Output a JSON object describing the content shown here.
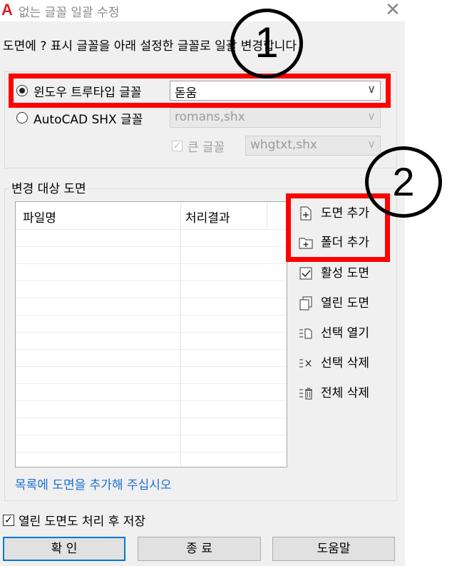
{
  "window": {
    "title": "없는 글꼴 일괄 수정",
    "app_icon": "A"
  },
  "prompt": "도면에 ? 표시 글꼴을 아래 설정한 글꼴로 일괄 변경합니다",
  "font_options": {
    "truetype": {
      "label": "윈도우 트루타입 글꼴",
      "selected": true,
      "value": "돋움"
    },
    "shx": {
      "label": "AutoCAD  SHX 글꼴",
      "selected": false,
      "value": "romans,shx"
    },
    "bigfont": {
      "label": "큰 글꼴",
      "checked": true,
      "value": "whgtxt,shx"
    }
  },
  "target_group": {
    "title": "변경 대상 도면",
    "columns": [
      "파일명",
      "처리결과"
    ],
    "hint": "목록에 도면을 추가해 주십시오"
  },
  "side_buttons": [
    {
      "label": "도면 추가",
      "icon": "add-drawing-icon"
    },
    {
      "label": "폴더 추가",
      "icon": "add-folder-icon"
    },
    {
      "label": "활성 도면",
      "icon": "active-drawing-icon"
    },
    {
      "label": "열린 도면",
      "icon": "open-drawings-icon"
    },
    {
      "label": "선택 열기",
      "icon": "open-selected-icon"
    },
    {
      "label": "선택 삭제",
      "icon": "delete-selected-icon"
    },
    {
      "label": "전체 삭제",
      "icon": "delete-all-icon"
    }
  ],
  "save_option": {
    "label": "열린 도면도 처리 후 저장",
    "checked": true
  },
  "buttons": {
    "ok": "확 인",
    "close": "종 료",
    "help": "도움말"
  },
  "annotations": {
    "one": "1",
    "two": "2"
  },
  "colors": {
    "highlight": "#ff0000",
    "accent": "#0078d7",
    "hint_text": "#1a6fd0"
  }
}
